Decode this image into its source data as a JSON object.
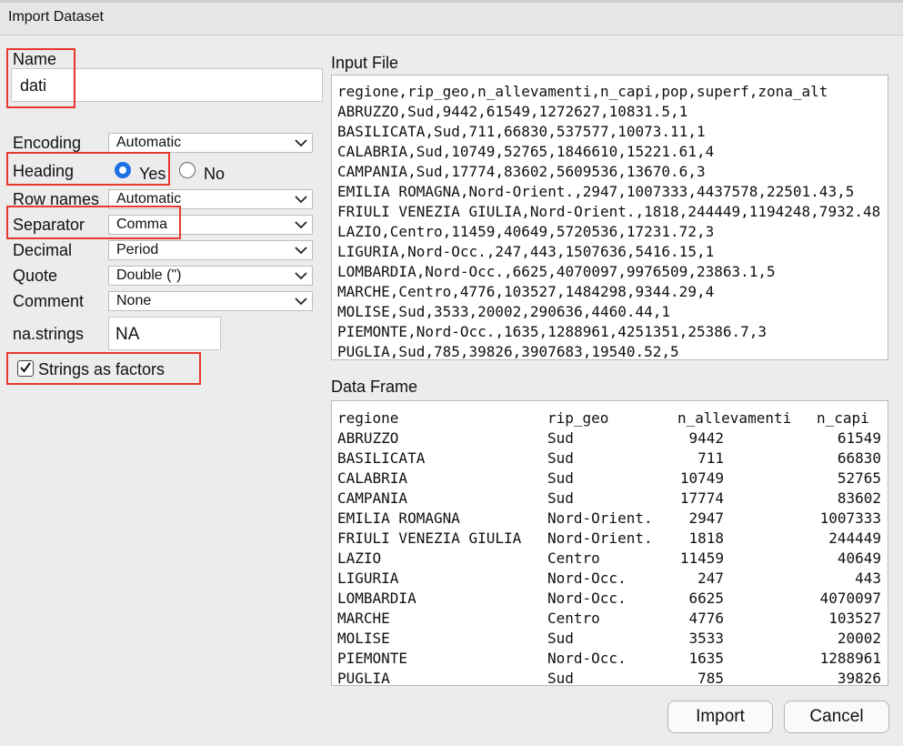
{
  "dialog": {
    "title": "Import Dataset"
  },
  "form": {
    "name_label": "Name",
    "name_value": "dati",
    "encoding_label": "Encoding",
    "encoding_value": "Automatic",
    "heading_label": "Heading",
    "heading_yes": "Yes",
    "heading_no": "No",
    "heading_selected": "Yes",
    "row_names_label": "Row names",
    "row_names_value": "Automatic",
    "separator_label": "Separator",
    "separator_value": "Comma",
    "decimal_label": "Decimal",
    "decimal_value": "Period",
    "quote_label": "Quote",
    "quote_value": "Double (\")",
    "comment_label": "Comment",
    "comment_value": "None",
    "na_label": "na.strings",
    "na_value": "NA",
    "strings_as_factors_label": "Strings as factors",
    "strings_as_factors_checked": true
  },
  "input_file": {
    "title": "Input File",
    "lines": [
      "regione,rip_geo,n_allevamenti,n_capi,pop,superf,zona_alt",
      "ABRUZZO,Sud,9442,61549,1272627,10831.5,1",
      "BASILICATA,Sud,711,66830,537577,10073.11,1",
      "CALABRIA,Sud,10749,52765,1846610,15221.61,4",
      "CAMPANIA,Sud,17774,83602,5609536,13670.6,3",
      "EMILIA ROMAGNA,Nord-Orient.,2947,1007333,4437578,22501.43,5",
      "FRIULI VENEZIA GIULIA,Nord-Orient.,1818,244449,1194248,7932.48",
      "LAZIO,Centro,11459,40649,5720536,17231.72,3",
      "LIGURIA,Nord-Occ.,247,443,1507636,5416.15,1",
      "LOMBARDIA,Nord-Occ.,6625,4070097,9976509,23863.1,5",
      "MARCHE,Centro,4776,103527,1484298,9344.29,4",
      "MOLISE,Sud,3533,20002,290636,4460.44,1",
      "PIEMONTE,Nord-Occ.,1635,1288961,4251351,25386.7,3",
      "PUGLIA,Sud,785,39826,3907683,19540.52,5"
    ]
  },
  "data_frame": {
    "title": "Data Frame",
    "headers": [
      "regione",
      "rip_geo",
      "n_allevamenti",
      "n_capi"
    ],
    "rows": [
      [
        "ABRUZZO",
        "Sud",
        "9442",
        "61549"
      ],
      [
        "BASILICATA",
        "Sud",
        "711",
        "66830"
      ],
      [
        "CALABRIA",
        "Sud",
        "10749",
        "52765"
      ],
      [
        "CAMPANIA",
        "Sud",
        "17774",
        "83602"
      ],
      [
        "EMILIA ROMAGNA",
        "Nord-Orient.",
        "2947",
        "1007333"
      ],
      [
        "FRIULI VENEZIA GIULIA",
        "Nord-Orient.",
        "1818",
        "244449"
      ],
      [
        "LAZIO",
        "Centro",
        "11459",
        "40649"
      ],
      [
        "LIGURIA",
        "Nord-Occ.",
        "247",
        "443"
      ],
      [
        "LOMBARDIA",
        "Nord-Occ.",
        "6625",
        "4070097"
      ],
      [
        "MARCHE",
        "Centro",
        "4776",
        "103527"
      ],
      [
        "MOLISE",
        "Sud",
        "3533",
        "20002"
      ],
      [
        "PIEMONTE",
        "Nord-Occ.",
        "1635",
        "1288961"
      ],
      [
        "PUGLIA",
        "Sud",
        "785",
        "39826"
      ]
    ]
  },
  "buttons": {
    "import": "Import",
    "cancel": "Cancel"
  },
  "colors": {
    "highlight": "#e5392e",
    "radio_accent": "#1f6fe5"
  },
  "icons": {
    "select_arrow": "chevron-down-icon",
    "check": "checkmark-icon"
  }
}
